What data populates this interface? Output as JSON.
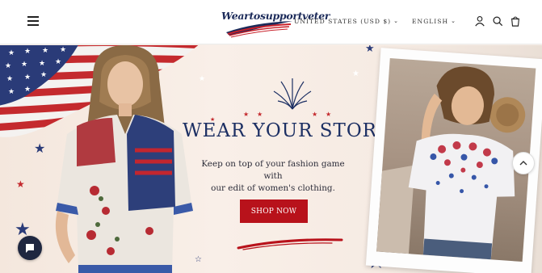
{
  "header": {
    "logo_text": "Weartosupportveter",
    "currency": "UNITED STATES (USD $)",
    "language": "ENGLISH"
  },
  "hero": {
    "headline": "WEAR YOUR STORY",
    "subtext_line1": "Keep on top of your fashion game with",
    "subtext_line2": "our edit of women's clothing.",
    "cta_label": "SHOP NOW"
  },
  "icons": {
    "menu": "hamburger-menu-icon",
    "account": "user-icon",
    "search": "search-icon",
    "cart": "shopping-bag-icon",
    "chat": "chat-icon",
    "scroll_top": "chevron-up-icon"
  },
  "colors": {
    "navy": "#1c2f63",
    "red": "#b8121b",
    "background": "#f7efe8"
  }
}
